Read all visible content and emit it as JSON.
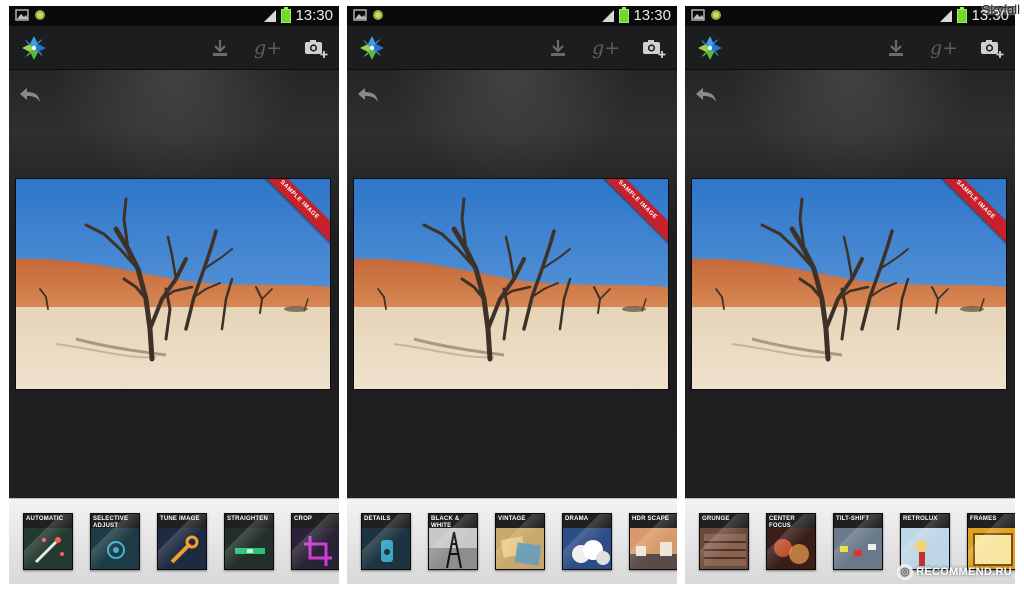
{
  "status_bar": {
    "time": "13:30"
  },
  "app": {
    "name_icon": "snapseed-logo",
    "action_icons": [
      "download-icon",
      "google-plus-icon",
      "camera-add-icon"
    ],
    "gplus_label": "g+"
  },
  "photo": {
    "badge": "SAMPLE IMAGE"
  },
  "panels": [
    {
      "tools": [
        {
          "label": "AUTOMATIC",
          "icon": "magic-wand-icon"
        },
        {
          "label": "SELECTIVE ADJUST",
          "icon": "target-icon"
        },
        {
          "label": "TUNE IMAGE",
          "icon": "wrench-icon"
        },
        {
          "label": "STRAIGHTEN",
          "icon": "level-icon"
        },
        {
          "label": "CROP",
          "icon": "crop-icon"
        }
      ]
    },
    {
      "tools": [
        {
          "label": "DETAILS",
          "icon": "details-icon"
        },
        {
          "label": "BLACK & WHITE",
          "icon": "eiffel-tower-icon"
        },
        {
          "label": "VINTAGE",
          "icon": "vintage-photo-icon"
        },
        {
          "label": "DRAMA",
          "icon": "clouds-icon"
        },
        {
          "label": "HDR SCAPE",
          "icon": "hdr-icon"
        }
      ]
    },
    {
      "tools": [
        {
          "label": "GRUNGE",
          "icon": "grunge-icon"
        },
        {
          "label": "CENTER FOCUS",
          "icon": "bokeh-icon"
        },
        {
          "label": "TILT-SHIFT",
          "icon": "tilt-shift-icon"
        },
        {
          "label": "RETROLUX",
          "icon": "retrolux-icon"
        },
        {
          "label": "FRAMES",
          "icon": "frames-icon"
        }
      ]
    }
  ],
  "watermark": {
    "title": "Skyfall",
    "site": "RECOMMEND.RU"
  },
  "colors": {
    "accent_ribbon": "#c6202a",
    "battery": "#6fdb2a"
  }
}
